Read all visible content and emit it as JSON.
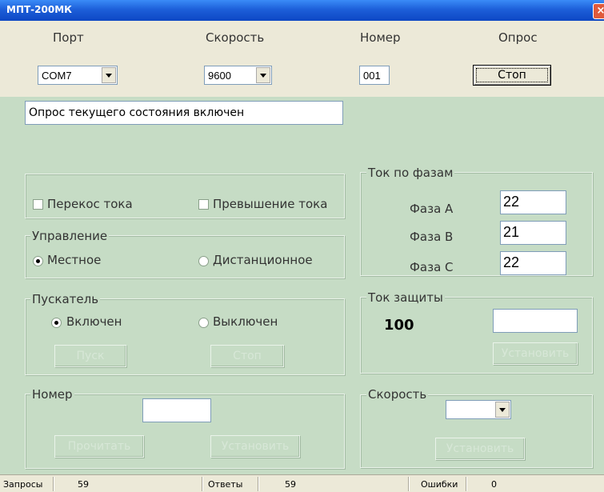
{
  "window": {
    "title": "МПТ-200МК"
  },
  "top": {
    "port": {
      "label": "Порт",
      "value": "COM7"
    },
    "speed": {
      "label": "Скорость",
      "value": "9600"
    },
    "number": {
      "label": "Номер",
      "value": "001"
    },
    "poll": {
      "label": "Опрос",
      "button": "Стоп"
    }
  },
  "status_message": "Опрос текущего состояния включен",
  "alarms": {
    "imbalance": "Перекос тока",
    "overcurrent": "Превышение тока"
  },
  "control": {
    "title": "Управление",
    "local": "Местное",
    "remote": "Дистанционное"
  },
  "starter": {
    "title": "Пускатель",
    "on": "Включен",
    "off": "Выключен",
    "start_btn": "Пуск",
    "stop_btn": "Стоп"
  },
  "number_group": {
    "title": "Номер",
    "value": "",
    "read_btn": "Прочитать",
    "set_btn": "Установить"
  },
  "phases": {
    "title": "Ток по фазам",
    "items": [
      {
        "label": "Фаза А",
        "value": "22"
      },
      {
        "label": "Фаза В",
        "value": "21"
      },
      {
        "label": "Фаза С",
        "value": "22"
      }
    ]
  },
  "protection": {
    "title": "Ток защиты",
    "value": "100",
    "input": "",
    "set_btn": "Установить"
  },
  "speed_group": {
    "title": "Скорость",
    "value": "",
    "set_btn": "Установить"
  },
  "statusbar": {
    "requests_label": "Запросы",
    "requests": "59",
    "answers_label": "Ответы",
    "answers": "59",
    "errors_label": "Ошибки",
    "errors": "0"
  }
}
